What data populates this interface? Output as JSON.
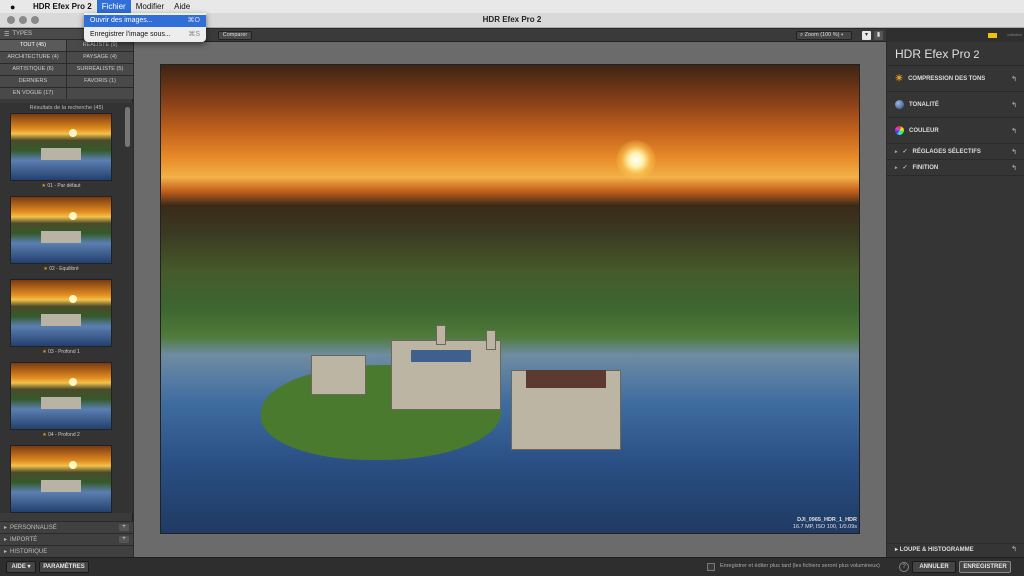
{
  "menubar": {
    "app": "HDR Efex Pro 2",
    "items": [
      "Fichier",
      "Modifier",
      "Aide"
    ]
  },
  "window": {
    "title": "HDR Efex Pro 2"
  },
  "file_menu": {
    "items": [
      {
        "label": "Ouvrir des images...",
        "shortcut": "⌘O"
      },
      {
        "label": "Enregistrer l'image sous...",
        "shortcut": "⌘S"
      }
    ]
  },
  "left": {
    "types_header": "TYPES",
    "filters": [
      "TOUT (45)",
      "RÉALISTE (9)",
      "ARCHITECTURE (4)",
      "PAYSAGE (4)",
      "ARTISTIQUE (6)",
      "SURRÉALISTE (5)",
      "DERNIERS",
      "FAVORIS (1)",
      "EN VOGUE (17)"
    ],
    "results_header": "Résultats de la recherche (45)",
    "presets": [
      "01 - Par défaut",
      "02 - Equilibré",
      "03 - Profond 1",
      "04 - Profond 2",
      ""
    ],
    "footer": [
      "PERSONNALISÉ",
      "IMPORTÉ",
      "HISTORIQUE"
    ]
  },
  "toolbar": {
    "compare": "Comparer",
    "zoom": "Zoom (100 %)"
  },
  "photo": {
    "filename": "DJI_0965_HDR_1_HDR",
    "meta": "16.7 MP, ISO 100, 1/0.09s"
  },
  "right": {
    "brand": "HDR Efex Pro",
    "version": "2",
    "collection_mark": "collection",
    "sections": [
      "COMPRESSION DES TONS",
      "TONALITÉ",
      "COULEUR",
      "RÉGLAGES SÉLECTIFS",
      "FINITION"
    ],
    "loupe": "LOUPE & HISTOGRAMME"
  },
  "bottom": {
    "help": "AIDE",
    "settings": "PARAMÈTRES",
    "save_note": "Enregistrer et éditer plus tard (les fichiers seront plus volumineux)",
    "cancel": "ANNULER",
    "save": "ENREGISTRER"
  },
  "colors": {
    "accent_menu": "#2f6fd6",
    "nik_logo": "#f0c010"
  }
}
